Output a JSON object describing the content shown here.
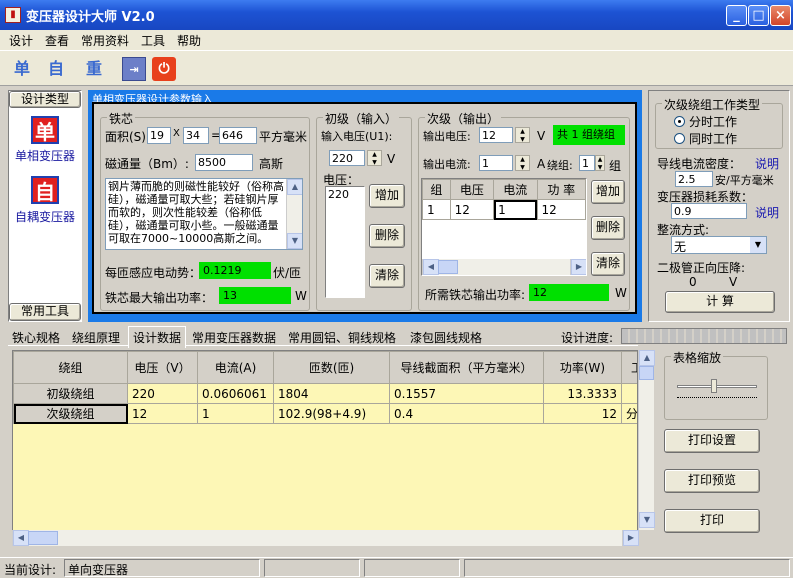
{
  "app": {
    "title": "变压器设计大师   V2.0"
  },
  "menu": [
    "设计",
    "查看",
    "常用资料",
    "工具",
    "帮助"
  ],
  "toolbar": {
    "b1": "单",
    "b2": "自",
    "b3": "重"
  },
  "left": {
    "group_title": "设计类型",
    "item1_icon": "单",
    "item1_label": "单相变压器",
    "item2_icon": "自",
    "item2_label": "自耦变压器",
    "footer": "常用工具"
  },
  "main_panel": {
    "title": "单相变压器设计参数输入"
  },
  "core": {
    "title": "铁芯",
    "area_label": "面积(S):",
    "a": "19",
    "x": "X",
    "b": "34",
    "eq": "=",
    "area": "646",
    "unit": "平方毫米",
    "flux_label": "磁通量（Bm）:",
    "flux": "8500",
    "flux_unit": "高斯",
    "note": "钢片薄而脆的则磁性能较好（俗称高硅），磁通量可取大些；若硅钢片厚而软的，则次性能较差（俗称低硅），磁通量可取小些。一般磁通量可取在7000~10000高斯之间。",
    "emf_label": "每匝感应电动势：",
    "emf": "0.1219",
    "emf_unit": "伏/匝",
    "pmax_label": "铁芯最大输出功率：",
    "pmax": "13",
    "pmax_unit": "W"
  },
  "primary": {
    "title": "初级（输入）",
    "volt_label": "输入电压(U1):",
    "volt": "220",
    "v": "V",
    "list_label": "电压：",
    "list": [
      "220"
    ],
    "add": "增加",
    "del": "删除",
    "clr": "清除"
  },
  "secondary": {
    "title": "次级（输出）",
    "volt_label": "输出电压:",
    "volt": "12",
    "v": "V",
    "cur_label": "输出电流:",
    "cur": "1",
    "a": "A",
    "count_text": "共 1 组绕组",
    "group_label": "绕组:",
    "group": "1",
    "group_unit": "组",
    "cols": [
      "组",
      "电压",
      "电流",
      "功 率"
    ],
    "rows": [
      [
        "1",
        "12",
        "1",
        "12"
      ]
    ],
    "add": "增加",
    "del": "删除",
    "clr": "清除",
    "power_label": "所需铁芯输出功率:",
    "power": "12",
    "power_unit": "W"
  },
  "right": {
    "mode_title": "次级绕组工作类型",
    "mode1": "分时工作",
    "mode2": "同时工作",
    "density_label": "导线电流密度：",
    "density_link": "说明",
    "density": "2.5",
    "density_unit": "安/平方毫米",
    "loss_label": "变压器损耗系数：",
    "loss": "0.9",
    "loss_link": "说明",
    "rect_label": "整流方式:",
    "rect": "无",
    "diode_label": "二极管正向压降:",
    "diode": "0",
    "diode_unit": "V",
    "calc": "计 算"
  },
  "tabs": [
    "铁心规格",
    "绕组原理",
    "设计数据",
    "常用变压器数据",
    "常用圆铝、铜线规格",
    "漆包圆线规格"
  ],
  "progress_label": "设计进度:",
  "result": {
    "cols": [
      "绕组",
      "电压（V）",
      "电流(A)",
      "匝数(匝)",
      "导线截面积（平方毫米）",
      "功率(W)",
      "工"
    ],
    "rows": [
      [
        "初级绕组",
        "220",
        "0.0606061",
        "1804",
        "0.1557",
        "13.3333",
        ""
      ],
      [
        "次级绕组",
        "12",
        "1",
        "102.9(98+4.9)",
        "0.4",
        "12",
        "分"
      ]
    ]
  },
  "zoom": {
    "title": "表格缩放",
    "print_setup": "打印设置",
    "print_preview": "打印预览",
    "print": "打印"
  },
  "status": {
    "label": "当前设计:",
    "value": "单向变压器"
  }
}
